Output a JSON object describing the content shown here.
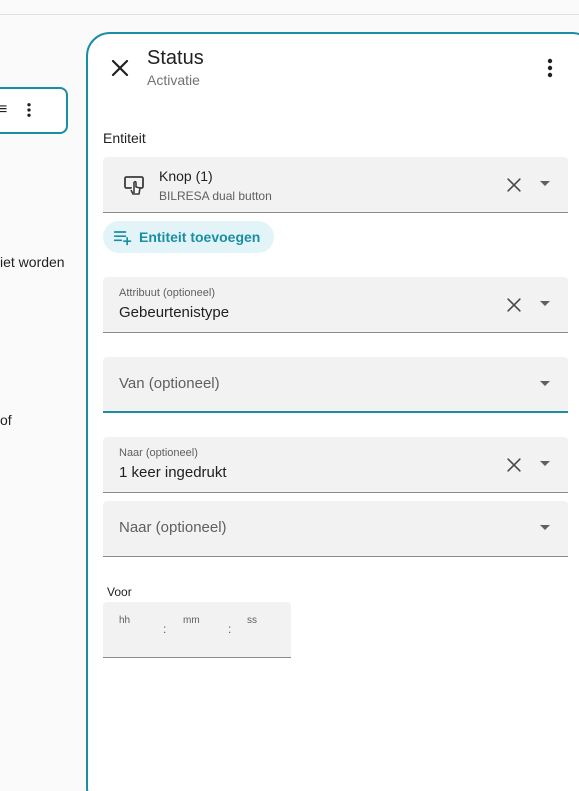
{
  "background": {
    "texts": [
      "iet worden",
      "of"
    ]
  },
  "dialog": {
    "title": "Status",
    "subtitle": "Activatie",
    "entity_section_label": "Entiteit",
    "entity": {
      "name": "Knop (1)",
      "device": "BILRESA dual button"
    },
    "add_entity_label": "Entiteit toevoegen",
    "attribute": {
      "label": "Attribuut (optioneel)",
      "value": "Gebeurtenistype"
    },
    "from_field": {
      "placeholder": "Van (optioneel)"
    },
    "to_field": {
      "label": "Naar (optioneel)",
      "value": "1 keer ingedrukt"
    },
    "to_field_2": {
      "placeholder": "Naar (optioneel)"
    },
    "for_section_label": "Voor",
    "duration": {
      "hh": "hh",
      "mm": "mm",
      "ss": "ss",
      "sep": ":"
    }
  },
  "colors": {
    "accent": "#1a8fa3",
    "chip_bg": "#e3f4f9",
    "field_bg": "#f2f2f2"
  }
}
